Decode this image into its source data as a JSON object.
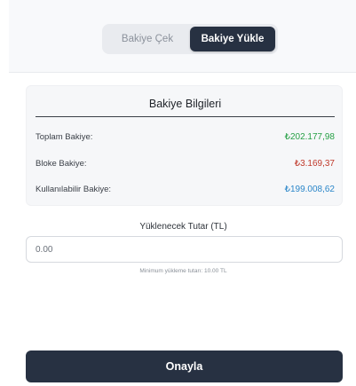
{
  "tabs": [
    {
      "label": "Bakiye Çek",
      "active": false
    },
    {
      "label": "Bakiye Yükle",
      "active": true
    }
  ],
  "balance_info": {
    "title": "Bakiye Bilgileri",
    "rows": [
      {
        "label": "Toplam Bakiye:",
        "value": "₺202.177,98",
        "color": "#27a046"
      },
      {
        "label": "Bloke Bakiye:",
        "value": "₺3.169,37",
        "color": "#c0392b"
      },
      {
        "label": "Kullanılabilir Bakiye:",
        "value": "₺199.008,62",
        "color": "#2a86c9"
      }
    ]
  },
  "amount": {
    "label": "Yüklenecek Tutar (TL)",
    "placeholder": "0.00",
    "hint": "Minimum yükleme tutarı: 10.00 TL"
  },
  "confirm_label": "Onayla",
  "colors": {
    "primary": "#273142",
    "positive": "#27a046",
    "negative": "#c0392b",
    "info": "#2a86c9"
  }
}
